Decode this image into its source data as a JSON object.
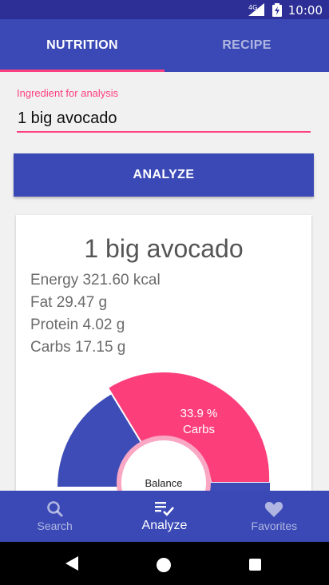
{
  "status_bar": {
    "time": "10:00",
    "network": "4G",
    "icons": [
      "cell-signal-icon",
      "battery-icon"
    ]
  },
  "tabs": [
    {
      "label": "NUTRITION",
      "active": true
    },
    {
      "label": "RECIPE",
      "active": false
    }
  ],
  "ingredient_field": {
    "label": "Ingredient for analysis",
    "value": "1 big avocado"
  },
  "analyze_button": {
    "label": "ANALYZE"
  },
  "result": {
    "title": "1 big avocado",
    "energy": "Energy 321.60 kcal",
    "fat": "Fat 29.47 g",
    "protein": "Protein 4.02 g",
    "carbs": "Carbs 17.15 g"
  },
  "chart_data": {
    "type": "pie",
    "slices": [
      {
        "name": "Carbs",
        "value": 33.9,
        "label": "33.9 %",
        "color": "#fc3f7b"
      },
      {
        "name": "",
        "value": null,
        "color": "#3d4cb7"
      }
    ],
    "center_label": "Balance"
  },
  "bottom_nav": [
    {
      "label": "Search",
      "icon": "search-icon",
      "active": false
    },
    {
      "label": "Analyze",
      "icon": "playlist-check-icon",
      "active": true
    },
    {
      "label": "Favorites",
      "icon": "heart-icon",
      "active": false
    }
  ],
  "colors": {
    "primary": "#3a49b5",
    "primary_dark": "#2d2f96",
    "accent": "#ff4081"
  }
}
